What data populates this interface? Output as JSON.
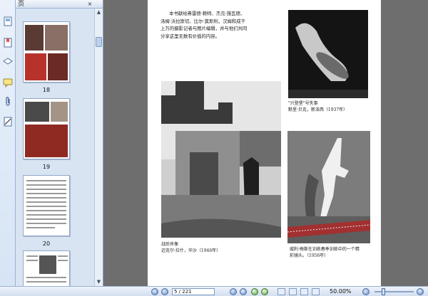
{
  "panel": {
    "title": "页",
    "close_icon": "×",
    "thumbs": [
      {
        "num": "18"
      },
      {
        "num": "19"
      },
      {
        "num": "20"
      }
    ]
  },
  "document": {
    "intro_lines": [
      "本书献给弗雷德·赖特、杰克·施瓦德、",
      "汤姆·沃拉斯切、比尔·莫斯利，汉姆和成千",
      "上万的摄影记者与图片编辑，并与他们共同",
      "分享这里无数有价值的内容。"
    ],
    "captions": {
      "hindenburg_title": "\"兴登堡\"号失事",
      "hindenburg_credit": "默里·贝克，新泽西（1937年）",
      "war_title": "战后肖像",
      "war_credit": "迈克尔·拉什，华沙（1946年）",
      "baseball_line1": "威利·梅斯在训练春季训练中的一个精",
      "baseball_line2": "彩镜头。（1956年）"
    }
  },
  "statusbar": {
    "page_value": "5 / 221",
    "zoom": "50.00%"
  },
  "icons": {
    "page_tool": "pages-icon",
    "bookmark_tool": "bookmark-icon",
    "layers_tool": "layers-icon",
    "comment_tool": "comment-icon",
    "attach_tool": "attachment-icon",
    "sign_tool": "signature-icon"
  }
}
